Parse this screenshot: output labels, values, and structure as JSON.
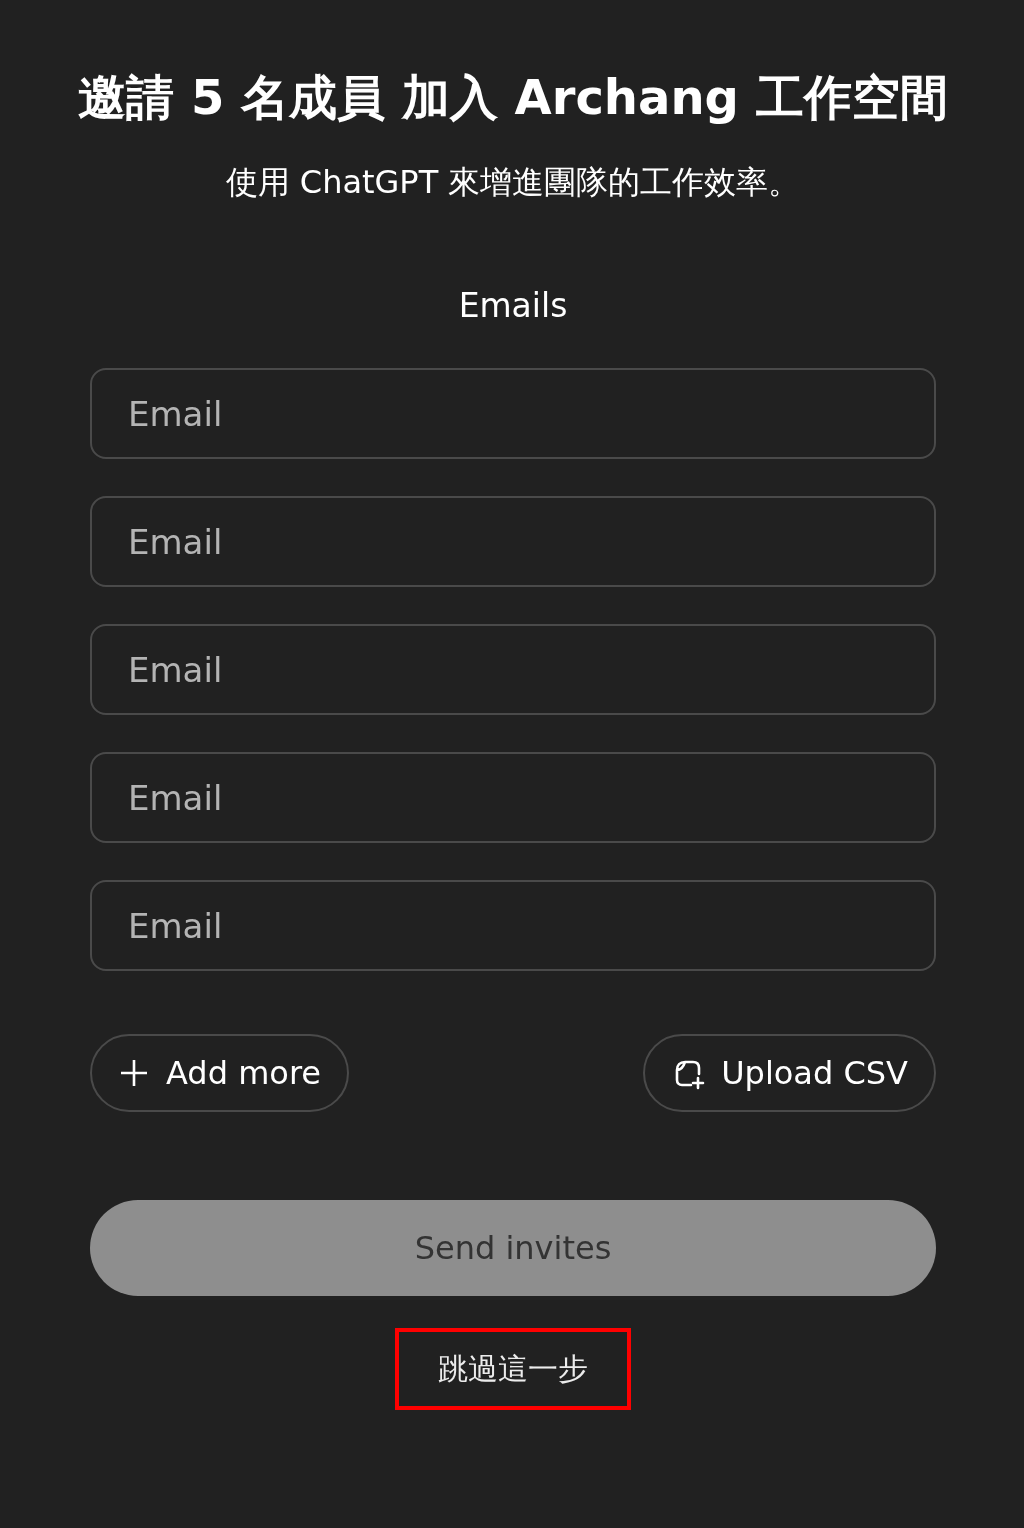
{
  "title": "邀請 5 名成員 加入 Archang 工作空間",
  "subtitle": "使用 ChatGPT 來增進團隊的工作效率。",
  "emails_label": "Emails",
  "email_fields": [
    {
      "placeholder": "Email"
    },
    {
      "placeholder": "Email"
    },
    {
      "placeholder": "Email"
    },
    {
      "placeholder": "Email"
    },
    {
      "placeholder": "Email"
    }
  ],
  "add_more_button": {
    "label": "Add more"
  },
  "upload_csv_button": {
    "label": "Upload CSV"
  },
  "send_button": {
    "label": "Send invites",
    "disabled": true
  },
  "skip_link": {
    "label": "跳過這一步",
    "highlighted": true
  }
}
